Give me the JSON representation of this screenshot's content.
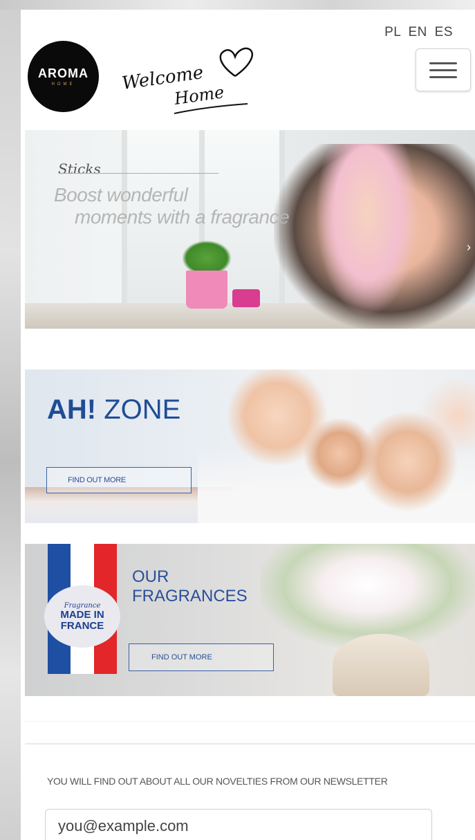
{
  "header": {
    "languages": [
      "PL",
      "EN",
      "ES"
    ],
    "logo": {
      "name": "AROMA",
      "sub": "HOME"
    },
    "welcome_line1": "Welcome",
    "welcome_line2": "Home",
    "menu_icon": "hamburger-icon"
  },
  "banners": {
    "sticks": {
      "tag": "Sticks",
      "line1": "Boost wonderful",
      "line2": "moments with a fragrance"
    },
    "ah_zone": {
      "title_bold": "AH!",
      "title_rest": "ZONE",
      "button": "FIND OUT MORE"
    },
    "fragrances": {
      "seal_small": "Fragrance",
      "seal_big": "MADE IN FRANCE",
      "title": "OUR FRAGRANCES",
      "button": "FIND OUT MORE",
      "flag_colors": [
        "#1f4fa3",
        "#ffffff",
        "#e2262a"
      ]
    }
  },
  "newsletter": {
    "label": "YOU WILL FIND OUT ABOUT ALL OUR NOVELTIES FROM OUR NEWSLETTER",
    "placeholder": "you@example.com"
  },
  "colors": {
    "brand_blue": "#1f4d96",
    "pink_pot": "#f08ab8"
  }
}
